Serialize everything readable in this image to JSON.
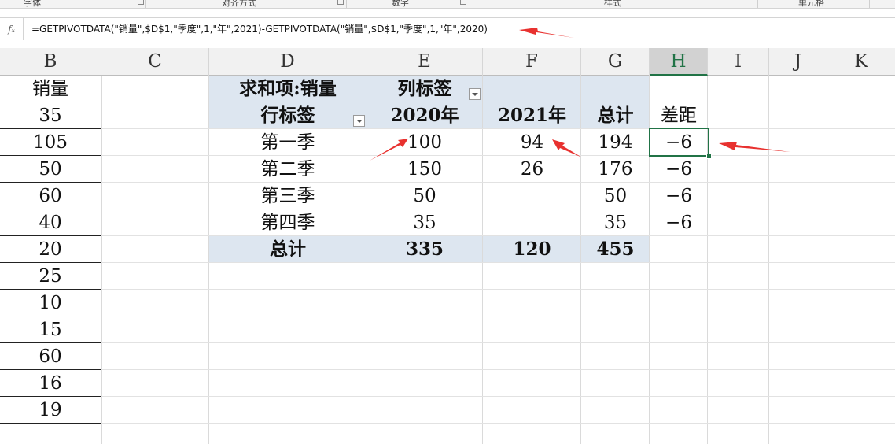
{
  "ribbon": {
    "groups": [
      "字体",
      "对齐方式",
      "数字",
      "样式",
      "单元格"
    ]
  },
  "formula_bar": {
    "fx_icon": "fx-icon",
    "formula": "=GETPIVOTDATA(\"销量\",$D$1,\"季度\",1,\"年\",2021)-GETPIVOTDATA(\"销量\",$D$1,\"季度\",1,\"年\",2020)"
  },
  "columns": [
    "B",
    "C",
    "D",
    "E",
    "F",
    "G",
    "H",
    "I",
    "J",
    "K"
  ],
  "selected_column": "H",
  "column_b": [
    "销量",
    "35",
    "105",
    "50",
    "60",
    "40",
    "20",
    "25",
    "10",
    "15",
    "60",
    "16",
    "19"
  ],
  "pivot": {
    "sum_label": "求和项:销量",
    "col_labels": "列标签",
    "row_labels": "行标签",
    "years": [
      "2020年",
      "2021年"
    ],
    "total_header": "总计",
    "rows": [
      {
        "label": "第一季",
        "y2020": "100",
        "y2021": "94",
        "total": "194"
      },
      {
        "label": "第二季",
        "y2020": "150",
        "y2021": "26",
        "total": "176"
      },
      {
        "label": "第三季",
        "y2020": "50",
        "y2021": "",
        "total": "50"
      },
      {
        "label": "第四季",
        "y2020": "35",
        "y2021": "",
        "total": "35"
      }
    ],
    "grand_total_label": "总计",
    "grand_totals": {
      "y2020": "335",
      "y2021": "120",
      "total": "455"
    }
  },
  "diff_column": {
    "header": "差距",
    "values": [
      "−6",
      "−6",
      "−6",
      "−6"
    ]
  },
  "colors": {
    "pivot_fill": "#dde6f0",
    "selection": "#217346",
    "arrow": "#e8312f"
  }
}
